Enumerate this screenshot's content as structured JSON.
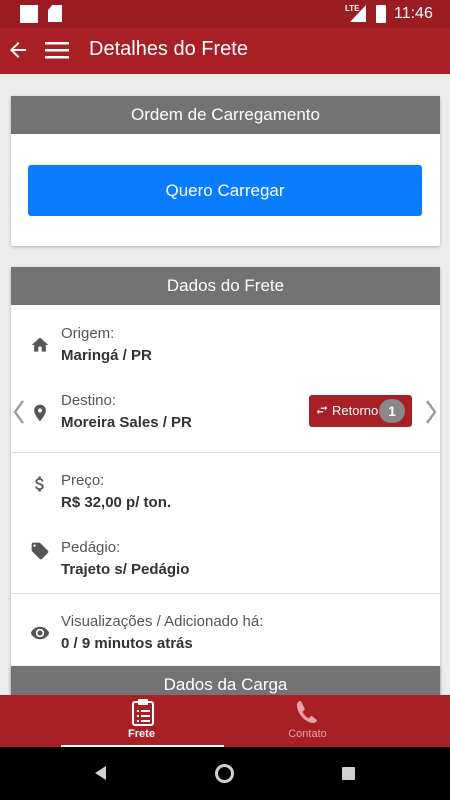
{
  "status_bar": {
    "time": "11:46",
    "network": "LTE"
  },
  "app_bar": {
    "title": "Detalhes do Frete"
  },
  "order_card": {
    "header": "Ordem de Carregamento",
    "button_label": "Quero Carregar"
  },
  "freight_card": {
    "header": "Dados do Frete",
    "origin": {
      "label": "Origem:",
      "value": "Maringá / PR"
    },
    "destination": {
      "label": "Destino:",
      "value": "Moreira Sales / PR"
    },
    "return_button": {
      "label": "Retorno",
      "count": "1"
    },
    "price": {
      "label": "Preço:",
      "value": "R$ 32,00 p/ ton."
    },
    "toll": {
      "label": "Pedágio:",
      "value": "Trajeto s/ Pedágio"
    },
    "views": {
      "label": "Visualizações / Adicionado há:",
      "value": "0 / 9 minutos atrás"
    }
  },
  "cargo_card": {
    "header": "Dados da Carga"
  },
  "bottom_nav": {
    "items": [
      {
        "label": "Frete",
        "icon": "clipboard-icon",
        "active": true
      },
      {
        "label": "Contato",
        "icon": "phone-icon",
        "active": false
      }
    ]
  },
  "colors": {
    "primary": "#a81f25",
    "accent_button": "#0a7cff",
    "card_header": "#737373"
  }
}
